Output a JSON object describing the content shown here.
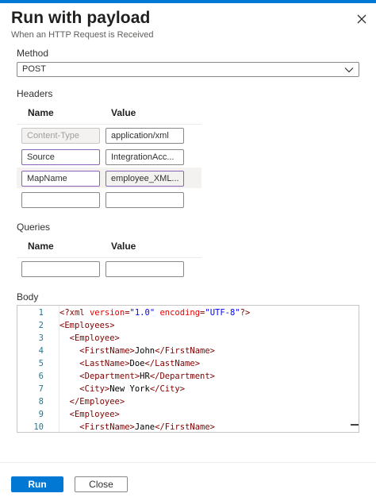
{
  "panel": {
    "title": "Run with payload",
    "subtitle": "When an HTTP Request is Received",
    "accent": "#0078d4",
    "close_icon": "close-icon"
  },
  "method": {
    "label": "Method",
    "value": "POST"
  },
  "headers": {
    "label": "Headers",
    "name_col": "Name",
    "value_col": "Value",
    "rows": [
      {
        "name": "Content-Type",
        "value": "application/xml"
      },
      {
        "name": "Source",
        "value": "IntegrationAcc..."
      },
      {
        "name": "MapName",
        "value": "employee_XML..."
      },
      {
        "name": "",
        "value": ""
      }
    ]
  },
  "queries": {
    "label": "Queries",
    "name_col": "Name",
    "value_col": "Value",
    "rows": [
      {
        "name": "",
        "value": ""
      }
    ]
  },
  "body": {
    "label": "Body",
    "lines": [
      {
        "n": "1",
        "indent": "",
        "parts": [
          [
            "pi",
            "<?xml "
          ],
          [
            "attr",
            "version"
          ],
          [
            "pi",
            "="
          ],
          [
            "str",
            "\"1.0\""
          ],
          [
            "pi",
            " "
          ],
          [
            "attr",
            "encoding"
          ],
          [
            "pi",
            "="
          ],
          [
            "str",
            "\"UTF-8\""
          ],
          [
            "pi",
            "?>"
          ]
        ]
      },
      {
        "n": "2",
        "indent": "",
        "parts": [
          [
            "pi",
            "<Employees>"
          ]
        ]
      },
      {
        "n": "3",
        "indent": "  ",
        "parts": [
          [
            "pi",
            "<Employee>"
          ]
        ]
      },
      {
        "n": "4",
        "indent": "    ",
        "parts": [
          [
            "pi",
            "<FirstName>"
          ],
          [
            "text",
            "John"
          ],
          [
            "pi",
            "</FirstName>"
          ]
        ]
      },
      {
        "n": "5",
        "indent": "    ",
        "parts": [
          [
            "pi",
            "<LastName>"
          ],
          [
            "text",
            "Doe"
          ],
          [
            "pi",
            "</LastName>"
          ]
        ]
      },
      {
        "n": "6",
        "indent": "    ",
        "parts": [
          [
            "pi",
            "<Department>"
          ],
          [
            "text",
            "HR"
          ],
          [
            "pi",
            "</Department>"
          ]
        ]
      },
      {
        "n": "7",
        "indent": "    ",
        "parts": [
          [
            "pi",
            "<City>"
          ],
          [
            "text",
            "New York"
          ],
          [
            "pi",
            "</City>"
          ]
        ]
      },
      {
        "n": "8",
        "indent": "  ",
        "parts": [
          [
            "pi",
            "</Employee>"
          ]
        ]
      },
      {
        "n": "9",
        "indent": "  ",
        "parts": [
          [
            "pi",
            "<Employee>"
          ]
        ]
      },
      {
        "n": "10",
        "indent": "    ",
        "parts": [
          [
            "pi",
            "<FirstName>"
          ],
          [
            "text",
            "Jane"
          ],
          [
            "pi",
            "</FirstName>"
          ]
        ]
      }
    ]
  },
  "footer": {
    "run_label": "Run",
    "close_label": "Close"
  }
}
